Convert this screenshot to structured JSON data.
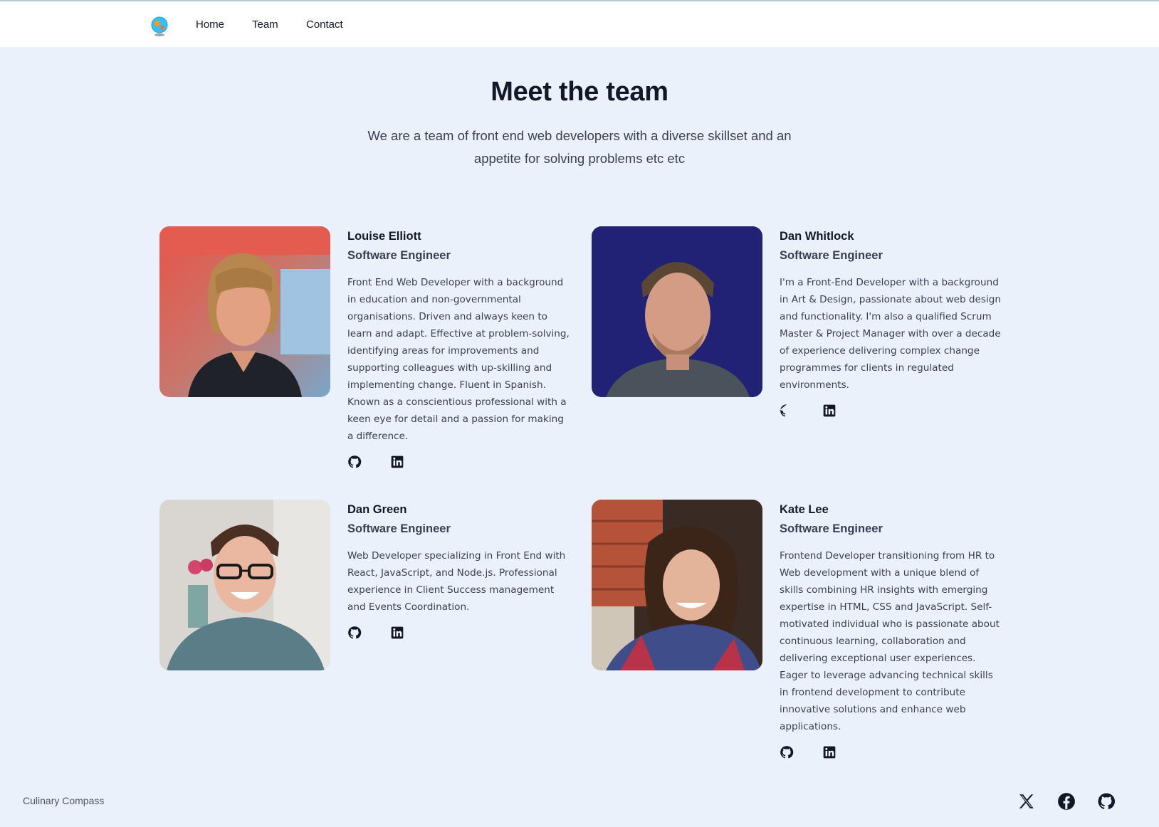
{
  "nav": {
    "logo": "globe-logo",
    "links": [
      "Home",
      "Team",
      "Contact"
    ]
  },
  "hero": {
    "title": "Meet the team",
    "subtitle": "We are a team of front end web developers with a diverse skillset and an appetite for solving problems etc etc"
  },
  "team": [
    {
      "name": "Louise Elliott",
      "role": "Software Engineer",
      "bio": "Front End Web Developer with a background in education and non-governmental organisations. Driven and always keen to learn and adapt. Effective at problem-solving, identifying areas for improvements and supporting colleagues with up-skilling and implementing change. Fluent in Spanish. Known as a conscientious professional with a keen eye for detail and a passion for making a difference.",
      "social": [
        "github-icon",
        "linkedin-icon"
      ]
    },
    {
      "name": "Dan Whitlock",
      "role": "Software Engineer",
      "bio": "I'm a Front-End Developer with a background in Art & Design, passionate about web design and functionality. I'm also a qualified Scrum Master & Project Manager with over a decade of experience delivering complex change programmes for clients in regulated environments.",
      "social": [
        "github-icon",
        "linkedin-icon"
      ]
    },
    {
      "name": "Dan Green",
      "role": "Software Engineer",
      "bio": "Web Developer specializing in Front End with React, JavaScript, and Node.js. Professional experience in Client Success management and Events Coordination.",
      "social": [
        "github-icon",
        "linkedin-icon"
      ]
    },
    {
      "name": "Kate Lee",
      "role": "Software Engineer",
      "bio": "Frontend Developer transitioning from HR to Web development with a unique blend of skills combining HR insights with emerging expertise in HTML, CSS and JavaScript. Self-motivated individual who is passionate about continuous learning, collaboration and delivering exceptional user experiences. Eager to leverage advancing technical skills in frontend development to contribute innovative solutions and enhance web applications.",
      "social": [
        "github-icon",
        "linkedin-icon"
      ]
    }
  ],
  "footer": {
    "brand": "Culinary Compass",
    "social": [
      "x-icon",
      "facebook-icon",
      "github-icon"
    ]
  },
  "colors": {
    "background": "#ebf1fa",
    "navbar": "#ffffff",
    "text": "#111827",
    "muted": "#374151"
  }
}
